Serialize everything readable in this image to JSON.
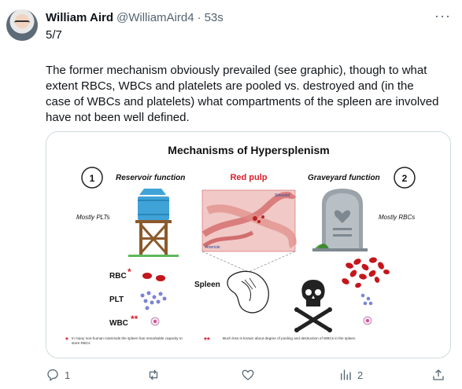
{
  "tweet": {
    "author_name": "William Aird",
    "handle": "@WilliamAird4",
    "separator": "·",
    "time": "53s",
    "counter": "5/7",
    "text": "The former mechanism obviously prevailed (see graphic), though to what extent RBCs, WBCs and platelets are pooled vs. destroyed and (in the case of WBCs and platelets) what compartments of the spleen are involved have not been well defined."
  },
  "graphic": {
    "title": "Mechanisms of Hypersplenism",
    "reservoir_number": "1",
    "reservoir_label": "Reservoir function",
    "red_pulp_label": "Red pulp",
    "graveyard_label": "Graveyard function",
    "graveyard_number": "2",
    "sinusoid_label": "Sinusoid",
    "arteriole_label": "Arteriole",
    "mostly_plts": "Mostly PLTs",
    "mostly_rbcs": "Mostly RBCs",
    "spleen_label": "Spleen",
    "rbc_label": "RBC",
    "plt_label": "PLT",
    "wbc_label": "WBC",
    "footnote1": "In many non-human mammals the spleen has remarkable capacity to store RBCs",
    "footnote2": "Much less is known about degree of pooling and destruction of WBCs in the spleen",
    "colors": {
      "red": "#d9202c",
      "plt": "#7b84d6",
      "tower_blue": "#3fa3d8",
      "tower_brown": "#8b5a2b"
    }
  },
  "actions": {
    "reply_count": "1",
    "retweet_count": "",
    "like_count": "",
    "views_count": "2",
    "icons": [
      "reply-icon",
      "retweet-icon",
      "like-icon",
      "views-icon",
      "share-icon"
    ]
  }
}
